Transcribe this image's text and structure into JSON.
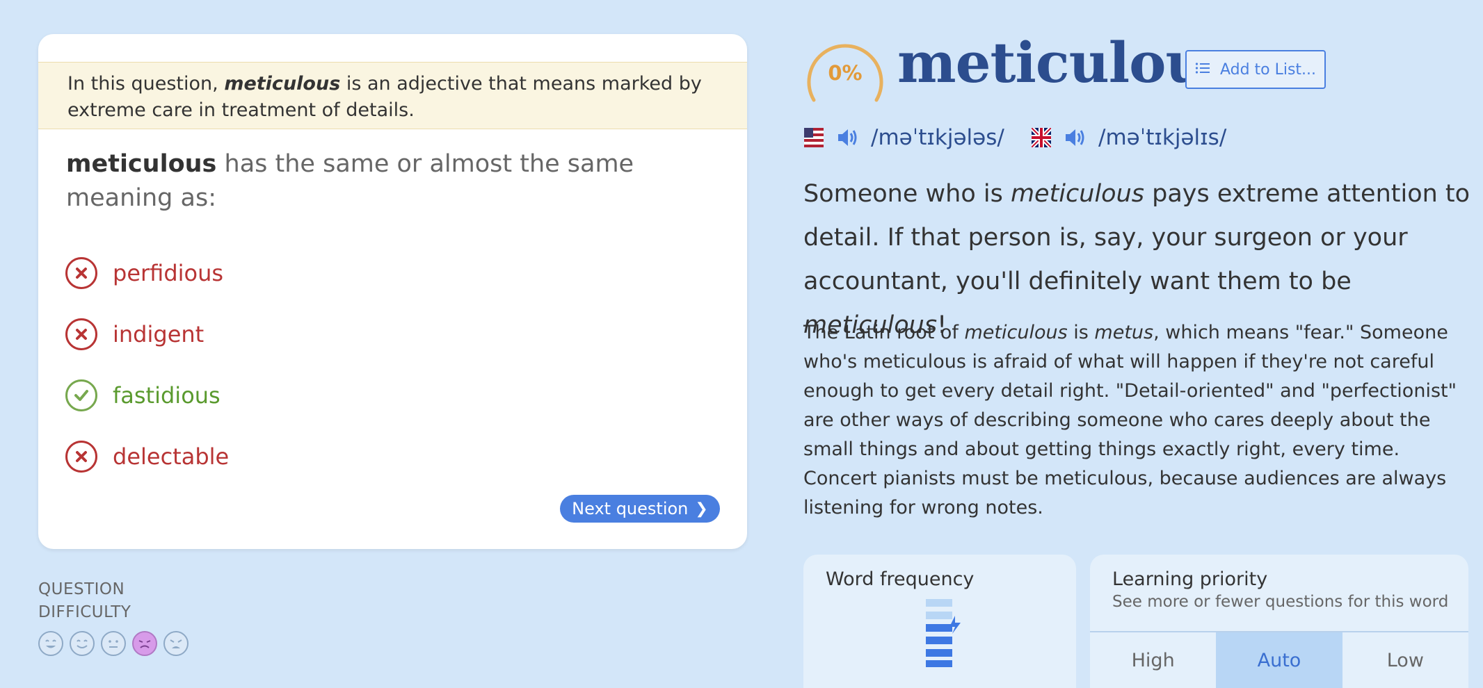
{
  "question": {
    "hint_prefix": "In this question, ",
    "hint_word": "meticulous",
    "hint_suffix": " is an adjective that means marked by extreme care in treatment of details.",
    "prompt_word": "meticulous",
    "prompt_text": " has the same or almost the same meaning as:",
    "choices": [
      {
        "label": "perfidious",
        "state": "wrong",
        "icon": "x-circle-icon"
      },
      {
        "label": "indigent",
        "state": "wrong",
        "icon": "x-circle-icon"
      },
      {
        "label": "fastidious",
        "state": "correct",
        "icon": "check-circle-icon"
      },
      {
        "label": "delectable",
        "state": "wrong",
        "icon": "x-circle-icon"
      }
    ],
    "next_label": "Next question",
    "next_icon": "chevron-right-icon"
  },
  "difficulty": {
    "label_line1": "QUESTION",
    "label_line2": "DIFFICULTY",
    "faces": [
      "very-easy-face-icon",
      "easy-face-icon",
      "neutral-face-icon",
      "hard-face-icon",
      "very-hard-face-icon"
    ],
    "selected_index": 3
  },
  "word": {
    "progress": "0%",
    "progress_fraction": 0,
    "title": "meticulous",
    "add_to_list": "Add to List...",
    "pron_us": "/məˈtɪkjələs/",
    "pron_uk": "/məˈtɪkjəlɪs/",
    "short_def_parts": [
      "Someone who is ",
      "meticulous",
      " pays extreme attention to detail. If that person is, say, your surgeon or your accountant, you'll definitely want them to be ",
      "meticulous",
      "!"
    ],
    "long_def_parts": [
      "The Latin root of ",
      "meticulous",
      " is ",
      "metus",
      ", which means \"fear.\" Someone who's meticulous is afraid of what will happen if they're not careful enough to get every detail right. \"Detail-oriented\" and \"perfectionist\" are other ways of describing someone who cares deeply about the small things and about getting things exactly right, every time. Concert pianists must be meticulous, because audiences are always listening for wrong notes."
    ]
  },
  "frequency": {
    "title": "Word frequency",
    "bars_total": 6,
    "bars_filled": 4
  },
  "priority": {
    "title": "Learning priority",
    "subtitle": "See more or fewer questions for this word",
    "options": [
      "High",
      "Auto",
      "Low"
    ],
    "selected": "Auto"
  },
  "colors": {
    "accent": "#4a7fe0",
    "wrong": "#b83434",
    "correct": "#5a9a2e",
    "progress": "#e29a3a",
    "title": "#2c4d8e"
  }
}
